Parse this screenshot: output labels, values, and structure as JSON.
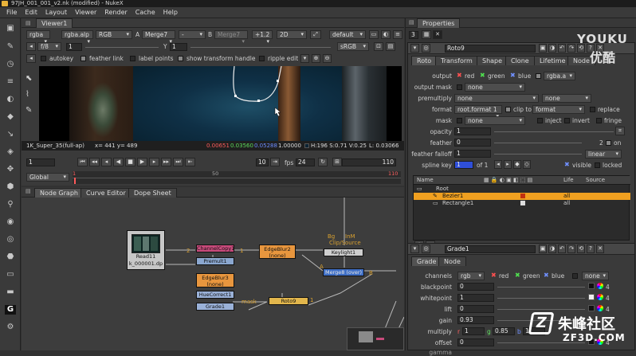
{
  "window": {
    "title": "97JH_001_001_v2.nk (modified) - NukeX"
  },
  "menu": [
    "File",
    "Edit",
    "Layout",
    "Viewer",
    "Render",
    "Cache",
    "Help"
  ],
  "viewer": {
    "tab": "Viewer1",
    "channels": "rgba",
    "layer": "rgba.alp",
    "display": "RGB",
    "a_label": "A",
    "a_input": "Merge7",
    "dash": "-",
    "b_label": "B",
    "b_input": "Merge7",
    "gain": "+1.2",
    "mode": "2D",
    "lut": "default",
    "fstop": "f/8",
    "frame1": "1",
    "y_label": "Y",
    "gamma": "1",
    "colorspace": "sRGB",
    "checks": [
      "autokey",
      "feather link",
      "label points",
      "show transform handle",
      "ripple edit"
    ],
    "info": {
      "format": "1K_Super_35(full-ap)",
      "xy": "x= 441 y= 489",
      "r": "0.00651",
      "g": "0.03560",
      "b": "0.05288",
      "a": "1.00000",
      "hsv": "H:196 S:0.71 V:0.25",
      "l": "L: 0.03066"
    },
    "playback": {
      "frame": "1",
      "step": "10",
      "fps_label": "fps",
      "fps": "24",
      "end": "110",
      "start_mark": "1",
      "mid": "50",
      "end_mark": "110",
      "mode": "Global"
    }
  },
  "graph": {
    "tabs": [
      "Node Graph",
      "Curve Editor",
      "Dope Sheet"
    ],
    "nodes": {
      "read": "Read11",
      "read_file": "k_000001.dp",
      "channelcopy": "ChannelCopy1",
      "premult": "Premult1",
      "edgeblur2": "EdgeBlur2",
      "edgeblur2_sub": "(none)",
      "edgeblur3": "EdgeBlur3",
      "edgeblur3_sub": "(none)",
      "keylight": "Keylight1",
      "merge": "Merge8 (over)",
      "huecorrect": "HueCorrect1",
      "grade": "Grade1",
      "roto": "Roto9"
    },
    "labels": {
      "bg": "Bg",
      "inm": "InM",
      "clip": "Clip/Source",
      "a": "A",
      "b": "B",
      "mask": "mask",
      "n2": "2",
      "n1": "1",
      "n3": "1"
    }
  },
  "properties": {
    "title": "Properties",
    "count": "3",
    "roto_name": "Roto9",
    "roto_tabs": [
      "Roto",
      "Transform",
      "Shape",
      "Clone",
      "Lifetime",
      "Node"
    ],
    "output_label": "output",
    "output_red": "red",
    "output_green": "green",
    "output_blue": "blue",
    "output_alpha": "rgba.a",
    "outmask_label": "output mask",
    "outmask": "none",
    "premult_label": "premultiply",
    "premult": "none",
    "premult2": "none",
    "format_label": "format",
    "format": "root.format 1",
    "clipto_label": "clip to",
    "clipto": "format",
    "replace": "replace",
    "mask_label": "mask",
    "mask": "none",
    "inject": "inject",
    "invert": "invert",
    "fringe": "fringe",
    "opacity_label": "opacity",
    "opacity": "1",
    "feather_label": "feather",
    "feather": "0",
    "feather_on": "on",
    "feather_n": "2",
    "falloff_label": "feather falloff",
    "falloff": "1",
    "falloff_type": "linear",
    "splinekey_label": "spline key",
    "splinekey": "1",
    "splinekey_of": "of 1",
    "visible": "visible",
    "locked": "locked",
    "layers": {
      "headers": [
        "Name",
        "Life",
        "Source"
      ],
      "rows": [
        {
          "name": "Root",
          "life": "",
          "src": ""
        },
        {
          "name": "Bezier1",
          "life": "all",
          "src": ""
        },
        {
          "name": "Rectangle1",
          "life": "all",
          "src": ""
        }
      ]
    },
    "grade_name": "Grade1",
    "grade_tabs": [
      "Grade",
      "Node"
    ],
    "channels_label": "channels",
    "channels": "rgb",
    "ch_red": "red",
    "ch_green": "green",
    "ch_blue": "blue",
    "ch_none": "none",
    "blackpoint_label": "blackpoint",
    "blackpoint": "0",
    "whitepoint_label": "whitepoint",
    "whitepoint": "1",
    "lift_label": "lift",
    "lift": "0",
    "gain_label": "gain",
    "gain": "0.93",
    "multiply_label": "multiply",
    "multiply_r": "1",
    "multiply_g": "0.85",
    "multiply_b": "1",
    "offset_label": "offset",
    "offset": "0",
    "gamma_label": "gamma",
    "four": "4"
  },
  "watermark": {
    "youku": "YOUKU",
    "youku_cn": "优酷",
    "site": "朱峰社区",
    "url": "ZF3D.COM"
  }
}
